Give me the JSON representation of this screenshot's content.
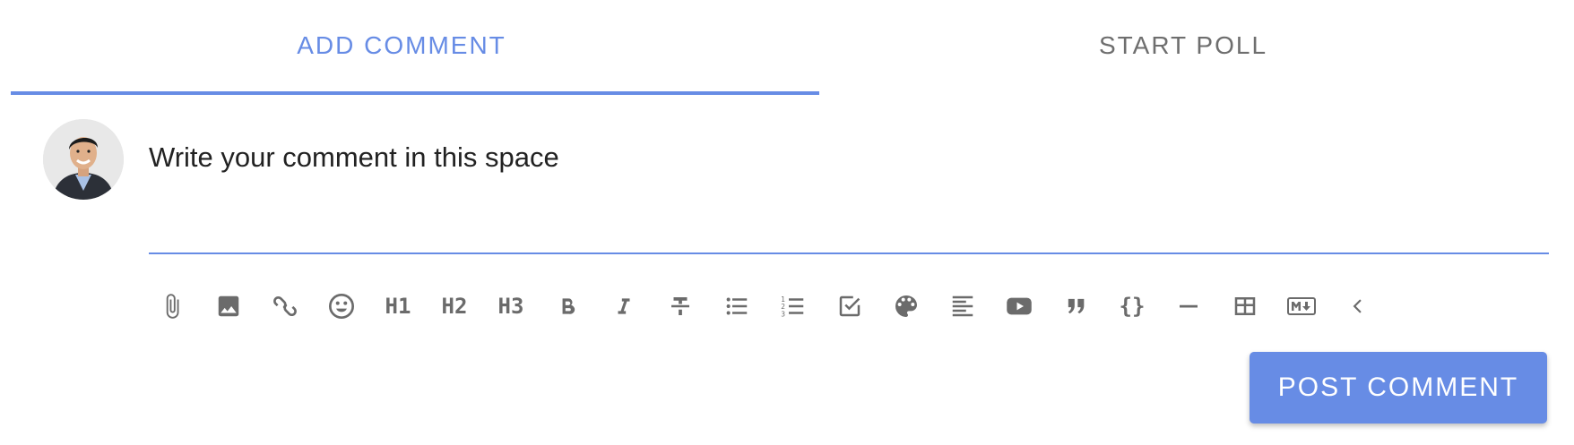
{
  "tabs": [
    {
      "label": "ADD COMMENT",
      "active": true
    },
    {
      "label": "START POLL",
      "active": false
    }
  ],
  "accent_color": "#678ce5",
  "editor": {
    "placeholder": "Write your comment in this space"
  },
  "toolbar": {
    "buttons": [
      {
        "name": "attach-icon"
      },
      {
        "name": "image-icon"
      },
      {
        "name": "link-icon"
      },
      {
        "name": "emoji-icon"
      },
      {
        "name": "heading-1-button",
        "label": "H1"
      },
      {
        "name": "heading-2-button",
        "label": "H2"
      },
      {
        "name": "heading-3-button",
        "label": "H3"
      },
      {
        "name": "bold-icon"
      },
      {
        "name": "italic-icon"
      },
      {
        "name": "strikethrough-icon"
      },
      {
        "name": "bulleted-list-icon"
      },
      {
        "name": "numbered-list-icon"
      },
      {
        "name": "checkbox-icon"
      },
      {
        "name": "palette-icon"
      },
      {
        "name": "align-left-icon"
      },
      {
        "name": "youtube-icon"
      },
      {
        "name": "quote-icon"
      },
      {
        "name": "code-braces-icon",
        "label": "{}"
      },
      {
        "name": "horizontal-rule-icon"
      },
      {
        "name": "table-icon"
      },
      {
        "name": "markdown-icon"
      },
      {
        "name": "chevron-left-icon"
      }
    ]
  },
  "submit": {
    "label": "POST COMMENT"
  }
}
